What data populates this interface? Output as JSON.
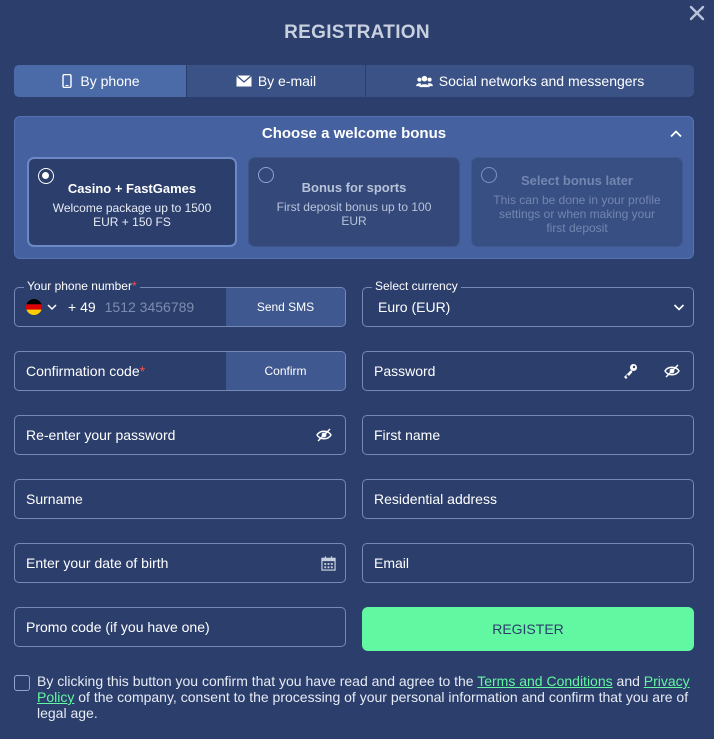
{
  "title": "REGISTRATION",
  "tabs": [
    {
      "label": "By phone",
      "icon": "phone-icon"
    },
    {
      "label": "By e-mail",
      "icon": "envelope-icon"
    },
    {
      "label": "Social networks and messengers",
      "icon": "people-icon"
    }
  ],
  "bonus": {
    "header": "Choose a welcome bonus",
    "options": [
      {
        "title": "Casino + FastGames",
        "desc": "Welcome package up to 1500 EUR + 150 FS"
      },
      {
        "title": "Bonus for sports",
        "desc": "First deposit bonus up to 100 EUR"
      },
      {
        "title": "Select bonus later",
        "desc": "This can be done in your profile settings or when making your first deposit"
      }
    ]
  },
  "phone": {
    "legend": "Your phone number",
    "code": "+ 49",
    "placeholder": "1512 3456789",
    "send_label": "Send SMS"
  },
  "currency": {
    "legend": "Select currency",
    "value": "Euro (EUR)"
  },
  "confirmation": {
    "label": "Confirmation code",
    "button": "Confirm"
  },
  "fields": {
    "password": "Password",
    "reenter": "Re-enter your password",
    "first_name": "First name",
    "surname": "Surname",
    "address": "Residential address",
    "dob": "Enter your date of birth",
    "email": "Email",
    "promo": "Promo code (if you have one)"
  },
  "register_label": "REGISTER",
  "consent": {
    "before": "By clicking this button you confirm that you have read and agree to the ",
    "terms": "Terms and Conditions",
    "and": " and ",
    "privacy": "Privacy Policy",
    "after": " of the company, consent to the processing of your personal information and confirm that you are of legal age."
  },
  "colors": {
    "background": "#2c3e6b",
    "accent": "#62f7a1",
    "required": "#ff4d4d"
  }
}
